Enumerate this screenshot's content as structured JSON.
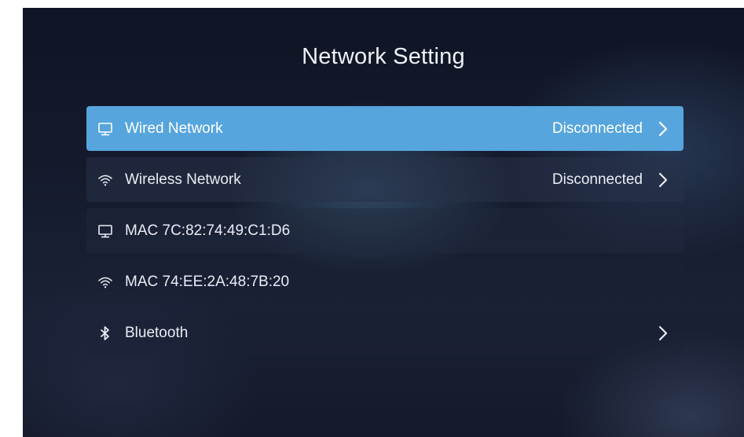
{
  "header": {
    "title": "Network Setting"
  },
  "menu": {
    "items": [
      {
        "icon": "monitor-icon",
        "label": "Wired Network",
        "status": "Disconnected",
        "has_arrow": true,
        "selected": true
      },
      {
        "icon": "wifi-icon",
        "label": "Wireless Network",
        "status": "Disconnected",
        "has_arrow": true,
        "selected": false
      },
      {
        "icon": "monitor-icon",
        "label": "MAC  7C:82:74:49:C1:D6",
        "status": "",
        "has_arrow": false,
        "selected": false
      },
      {
        "icon": "wifi-icon",
        "label": "MAC  74:EE:2A:48:7B:20",
        "status": "",
        "has_arrow": false,
        "selected": false
      },
      {
        "icon": "bluetooth-icon",
        "label": "Bluetooth",
        "status": "",
        "has_arrow": true,
        "selected": false
      }
    ]
  },
  "colors": {
    "selected_row": "#56a5dd",
    "background": "#141a2c",
    "text": "#e9edf3"
  }
}
